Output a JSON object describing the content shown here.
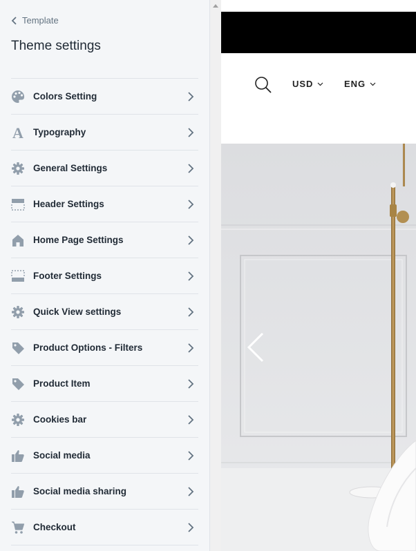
{
  "sidebar": {
    "back_label": "Template",
    "title": "Theme settings",
    "items": [
      {
        "label": "Colors Setting",
        "icon": "palette-icon"
      },
      {
        "label": "Typography",
        "icon": "typography-icon"
      },
      {
        "label": "General Settings",
        "icon": "gear-icon"
      },
      {
        "label": "Header Settings",
        "icon": "header-layout-icon"
      },
      {
        "label": "Home Page Settings",
        "icon": "home-icon"
      },
      {
        "label": "Footer Settings",
        "icon": "footer-layout-icon"
      },
      {
        "label": "Quick View settings",
        "icon": "gear-icon"
      },
      {
        "label": "Product Options - Filters",
        "icon": "tag-icon"
      },
      {
        "label": "Product Item",
        "icon": "tag-icon"
      },
      {
        "label": "Cookies bar",
        "icon": "gear-icon"
      },
      {
        "label": "Social media",
        "icon": "thumbs-up-icon"
      },
      {
        "label": "Social media sharing",
        "icon": "thumbs-up-icon"
      },
      {
        "label": "Checkout",
        "icon": "cart-icon"
      }
    ]
  },
  "preview": {
    "currency": "USD",
    "language": "ENG"
  },
  "colors": {
    "icon": "#919eab",
    "text": "#212b36",
    "muted": "#637381",
    "border": "#dfe3e8"
  }
}
